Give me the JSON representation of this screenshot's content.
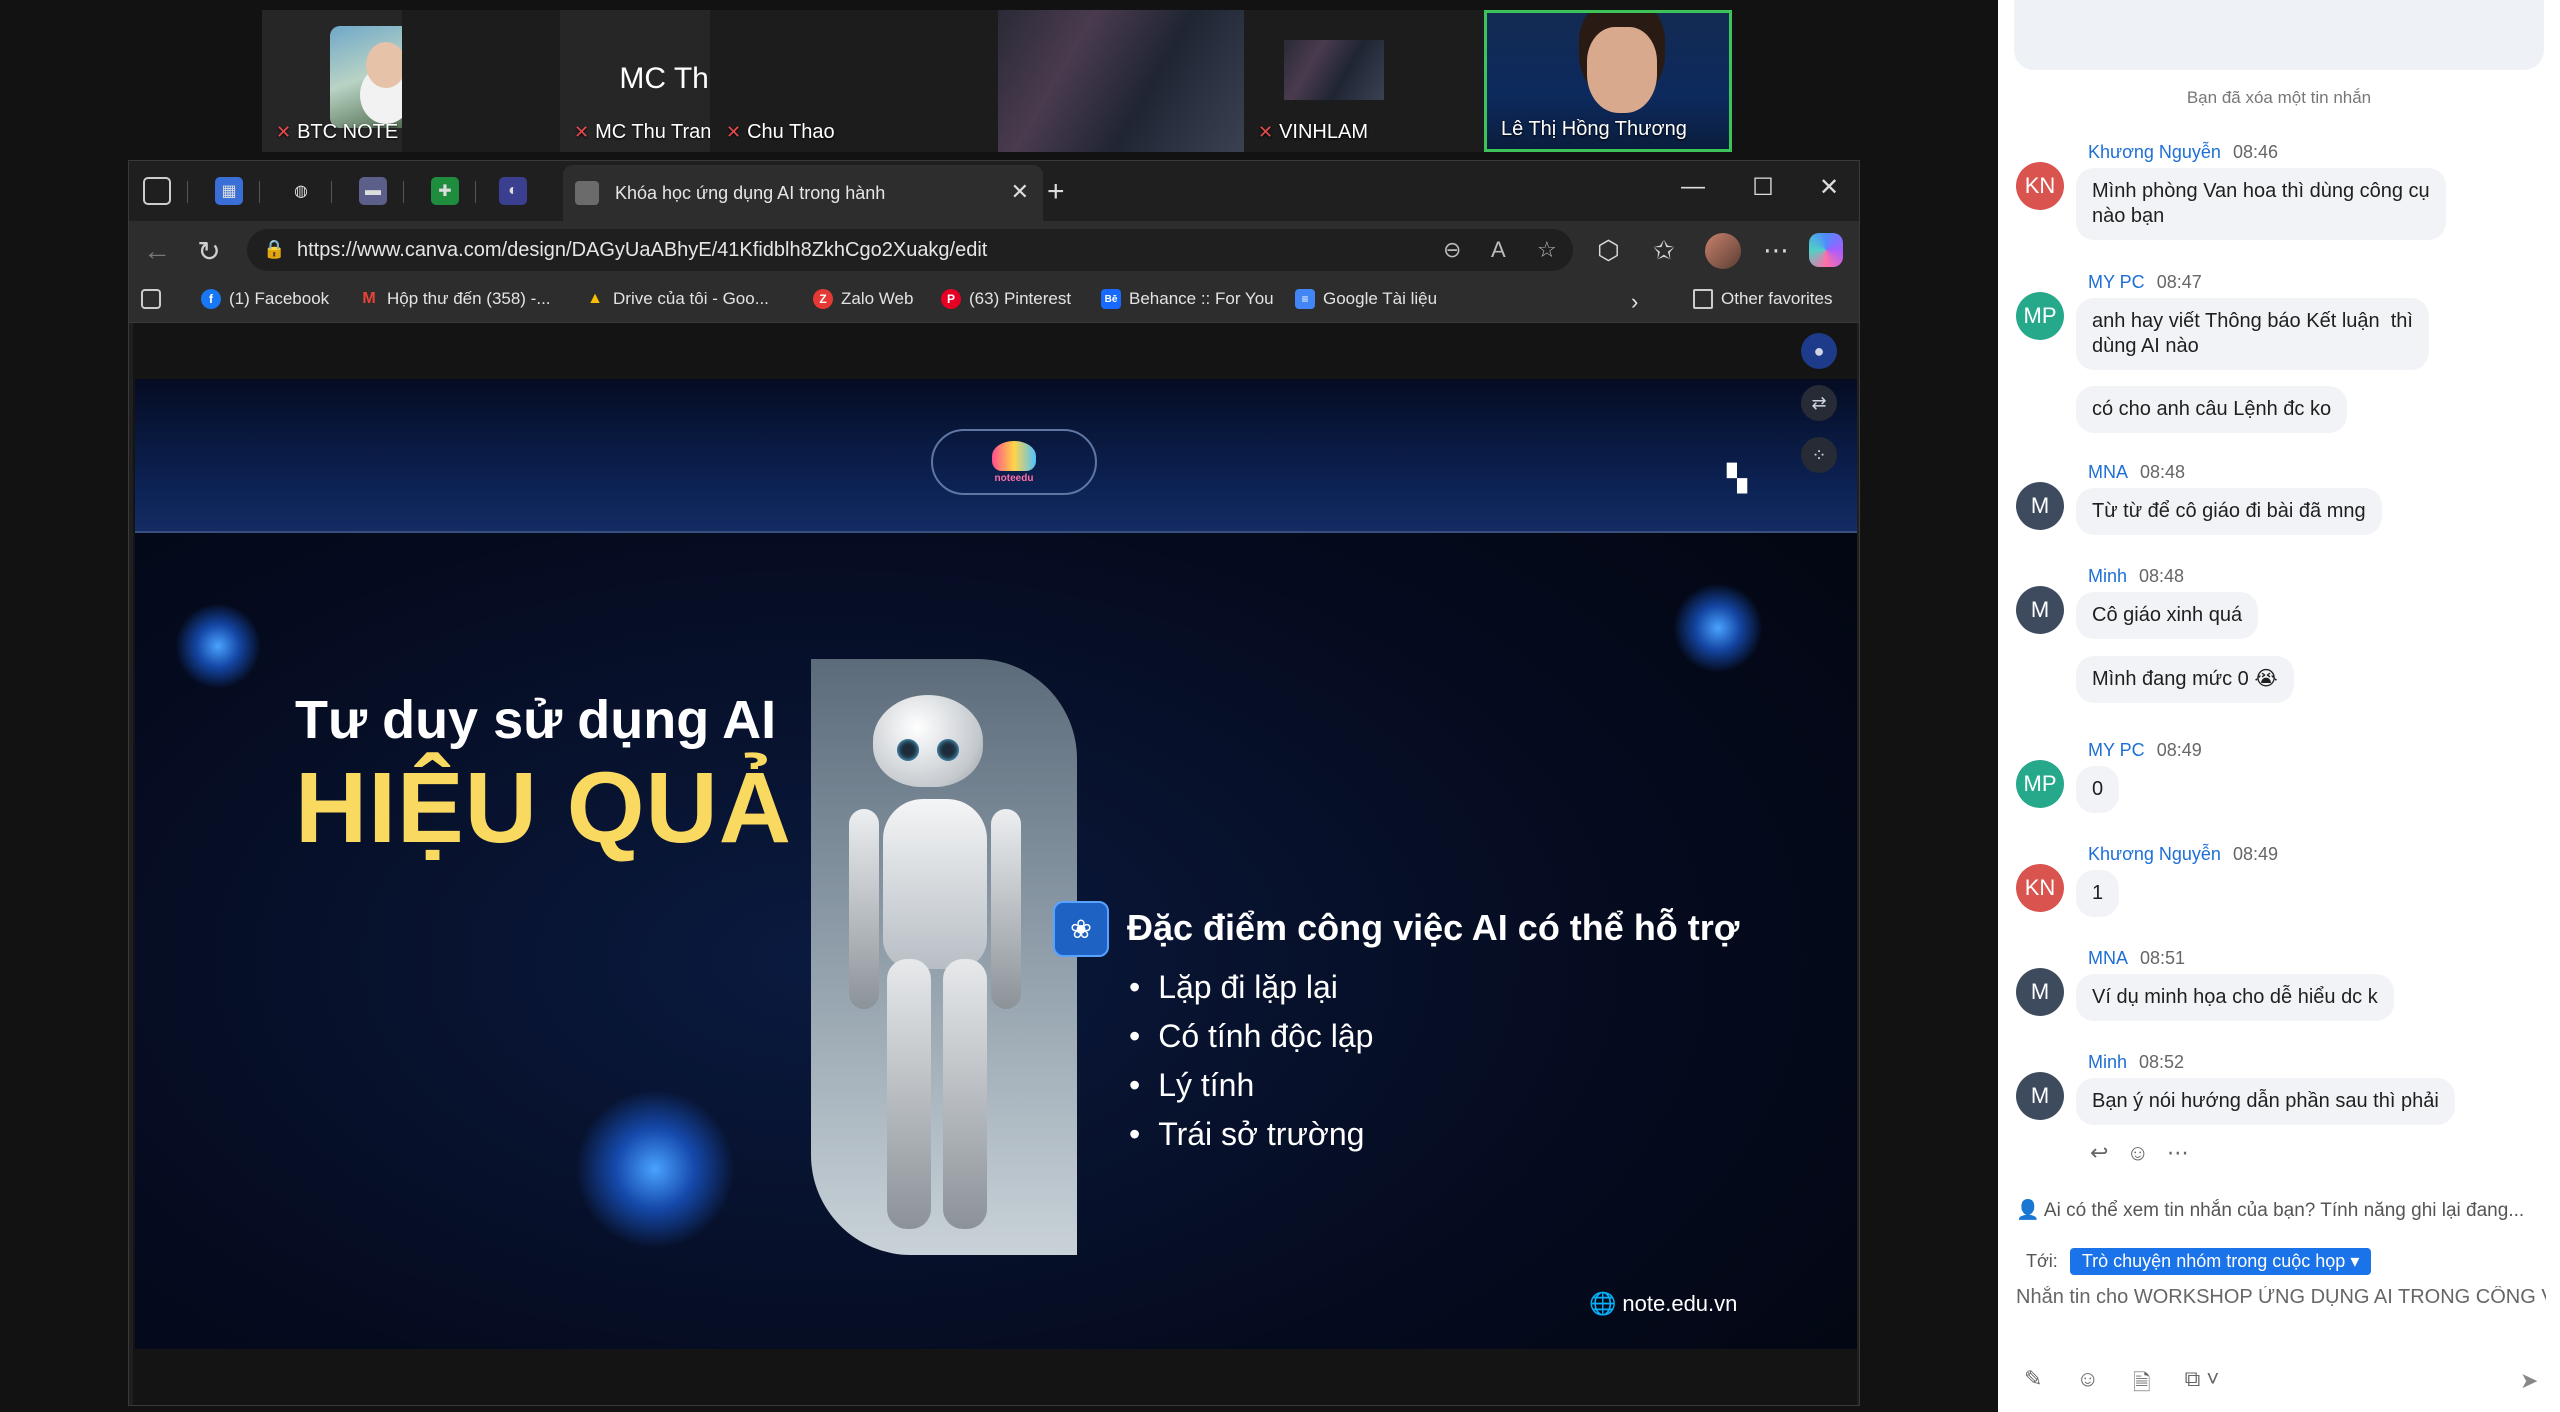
{
  "participants": [
    {
      "name": "BTC NOTE EDU",
      "muted": true
    },
    {
      "name": "MC Thu Trang",
      "display_name": "MC Thu Trang",
      "muted": true
    },
    {
      "name": "Chu Thao",
      "muted": true
    },
    {
      "name": "VINHLAM",
      "muted": true
    },
    {
      "name": "Lê Thị Hồng Thương",
      "active": true
    }
  ],
  "browser": {
    "tab_title": "Khóa học ứng dụng AI trong hành",
    "url": "https://www.canva.com/design/DAGyUaABhyE/41Kfidblh8ZkhCgo2Xuakg/edit",
    "bookmarks": [
      {
        "label": "(1) Facebook",
        "icon": "facebook-icon",
        "color": "#1877f2"
      },
      {
        "label": "Hộp thư đến (358) -...",
        "icon": "gmail-icon",
        "color": "#ea4335"
      },
      {
        "label": "Drive của tôi - Goo...",
        "icon": "drive-icon",
        "color": "#34a853"
      },
      {
        "label": "Zalo Web",
        "icon": "zalo-icon",
        "color": "#e53935"
      },
      {
        "label": "(63) Pinterest",
        "icon": "pinterest-icon",
        "color": "#e60023"
      },
      {
        "label": "Behance :: For You",
        "icon": "behance-icon",
        "color": "#1769ff"
      },
      {
        "label": "Google Tài liệu",
        "icon": "docs-icon",
        "color": "#4285f4"
      }
    ],
    "other_favorites": "Other favorites"
  },
  "slide": {
    "title_line1": "Tư duy sử dụng AI",
    "title_line2": "HIỆU QUẢ",
    "feature_title": "Đặc điểm công việc AI có thể hỗ trợ",
    "features": [
      "Lặp đi lặp lại",
      "Có tính độc lập",
      "Lý tính",
      "Trái sở trường"
    ],
    "site": "note.edu.vn",
    "logo_text": "noteedu",
    "title_color": "#fad961"
  },
  "chat": {
    "deleted_note": "Bạn đã xóa một tin nhắn",
    "messages": [
      {
        "sender": "Khương Nguyễn",
        "initials": "KN",
        "time": "08:46",
        "color": "#d9534f",
        "texts": [
          "Mình phòng Van hoa thì dùng công cụ\nnào bạn"
        ]
      },
      {
        "sender": "MY PC",
        "initials": "MP",
        "time": "08:47",
        "color": "#26a98b",
        "texts": [
          "anh hay viết Thông báo Kết luận  thì\ndùng AI nào",
          "có cho anh câu Lệnh đc ko"
        ]
      },
      {
        "sender": "MNA",
        "initials": "M",
        "time": "08:48",
        "color": "#3e4a5e",
        "texts": [
          "Từ từ để cô giáo đi bài đã mng"
        ]
      },
      {
        "sender": "Minh",
        "initials": "M",
        "time": "08:48",
        "color": "#3e4a5e",
        "texts": [
          "Cô giáo xinh quá",
          "Mình đang mức 0 😭"
        ]
      },
      {
        "sender": "MY PC",
        "initials": "MP",
        "time": "08:49",
        "color": "#26a98b",
        "texts": [
          "0"
        ]
      },
      {
        "sender": "Khương Nguyễn",
        "initials": "KN",
        "time": "08:49",
        "color": "#d9534f",
        "texts": [
          "1"
        ]
      },
      {
        "sender": "MNA",
        "initials": "M",
        "time": "08:51",
        "color": "#3e4a5e",
        "texts": [
          "Ví dụ minh họa cho dễ hiểu dc k"
        ]
      },
      {
        "sender": "Minh",
        "initials": "M",
        "time": "08:52",
        "color": "#3e4a5e",
        "texts": [
          "Bạn ý nói hướng dẫn phần sau thì phải"
        ]
      }
    ],
    "privacy_note": "Ai có thể xem tin nhắn của bạn? Tính năng ghi lại đang...",
    "to_label": "Tới:",
    "to_target": "Trò chuyện nhóm trong cuộc họp",
    "compose_placeholder": "Nhắn tin cho WORKSHOP ỨNG DỤNG AI TRONG CÔNG VI..."
  }
}
